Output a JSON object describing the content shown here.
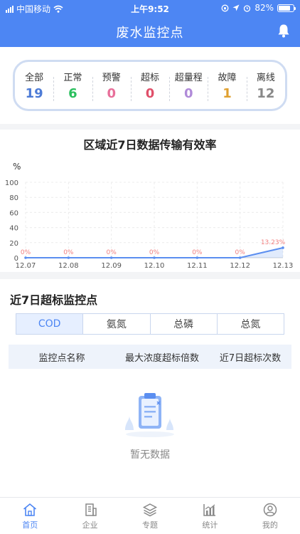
{
  "status_bar": {
    "carrier": "中国移动",
    "time": "上午9:52",
    "battery": "82%",
    "battery_level": 0.82
  },
  "header": {
    "title": "废水监控点"
  },
  "summary": [
    {
      "label": "全部",
      "value": "19",
      "color": "#4d7bd6"
    },
    {
      "label": "正常",
      "value": "6",
      "color": "#2bbf5e"
    },
    {
      "label": "预警",
      "value": "0",
      "color": "#e86f9a"
    },
    {
      "label": "超标",
      "value": "0",
      "color": "#e0506a"
    },
    {
      "label": "超量程",
      "value": "0",
      "color": "#b08ad8"
    },
    {
      "label": "故障",
      "value": "1",
      "color": "#e0a030"
    },
    {
      "label": "离线",
      "value": "12",
      "color": "#888888"
    }
  ],
  "chart_data": {
    "type": "area",
    "title": "区域近7日数据传输有效率",
    "ylabel": "%",
    "ylim": [
      0,
      100
    ],
    "yticks": [
      "0",
      "20",
      "40",
      "60",
      "80",
      "100"
    ],
    "categories": [
      "12.07",
      "12.08",
      "12.09",
      "12.10",
      "12.11",
      "12.12",
      "12.13"
    ],
    "values": [
      0,
      0,
      0,
      0,
      0,
      0,
      13.23
    ],
    "data_labels": [
      "0%",
      "0%",
      "0%",
      "0%",
      "0%",
      "0%",
      "13.23%"
    ],
    "grid": true,
    "line_color": "#5b8ef0",
    "label_color": "#f08080"
  },
  "exceed": {
    "title": "近7日超标监控点",
    "tabs": [
      "COD",
      "氨氮",
      "总磷",
      "总氮"
    ],
    "active_tab": 0,
    "columns": [
      "监控点名称",
      "最大浓度超标倍数",
      "近7日超标次数"
    ],
    "empty_text": "暂无数据"
  },
  "nav": [
    {
      "label": "首页",
      "icon": "home-icon",
      "active": true
    },
    {
      "label": "企业",
      "icon": "building-icon",
      "active": false
    },
    {
      "label": "专题",
      "icon": "layers-icon",
      "active": false
    },
    {
      "label": "统计",
      "icon": "chart-icon",
      "active": false
    },
    {
      "label": "我的",
      "icon": "user-icon",
      "active": false
    }
  ]
}
